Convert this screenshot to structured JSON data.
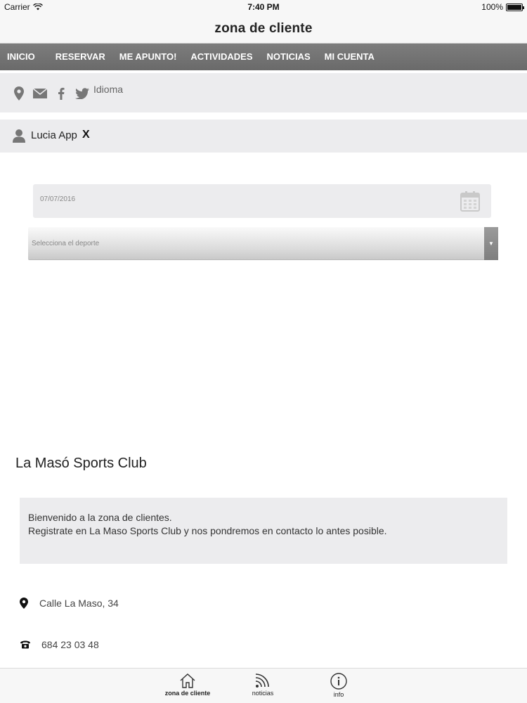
{
  "status_bar": {
    "carrier": "Carrier",
    "time": "7:40 PM",
    "battery": "100%",
    "battery_level": 1.0
  },
  "nav_bar": {
    "title": "zona de cliente"
  },
  "menu": {
    "items": [
      {
        "label": "INICIO"
      },
      {
        "label": "RESERVAR"
      },
      {
        "label": "ME APUNTO!"
      },
      {
        "label": "ACTIVIDADES"
      },
      {
        "label": "NOTICIAS"
      },
      {
        "label": "MI CUENTA"
      }
    ]
  },
  "social": {
    "icons": [
      "map-pin-icon",
      "mail-icon",
      "facebook-icon",
      "twitter-icon"
    ],
    "language_label": "Idioma"
  },
  "user": {
    "name": "Lucia App",
    "logout_label": "X"
  },
  "form": {
    "date_value": "07/07/2016",
    "sport_placeholder": "Selecciona el deporte"
  },
  "club": {
    "name": "La Masó Sports Club",
    "welcome_line1": "Bienvenido a la zona de clientes.",
    "welcome_line2": "Registrate en La Maso Sports Club y nos pondremos en contacto lo antes posible.",
    "address": "Calle La Maso, 34",
    "phone": "684 23 03 48"
  },
  "tab_bar": {
    "tabs": [
      {
        "label": "zona de cliente",
        "icon": "home-icon"
      },
      {
        "label": "noticias",
        "icon": "rss-icon"
      },
      {
        "label": "info",
        "icon": "info-icon"
      }
    ]
  },
  "colors": {
    "menu_bg": "#737373",
    "panel_bg": "#ececee",
    "text": "#222222"
  }
}
